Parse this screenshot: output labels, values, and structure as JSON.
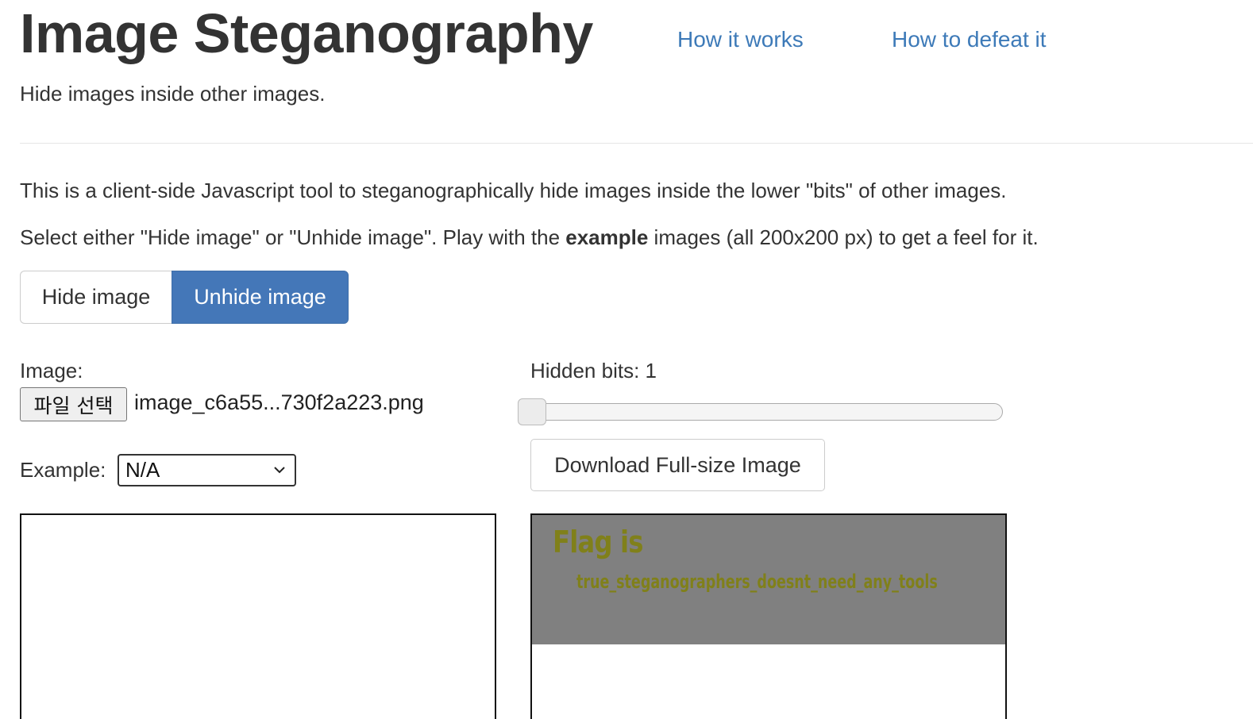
{
  "header": {
    "title": "Image Steganography",
    "nav": [
      "How it works",
      "How to defeat it"
    ],
    "subtitle": "Hide images inside other images."
  },
  "intro": {
    "line1": "This is a client-side Javascript tool to steganographically hide images inside the lower \"bits\" of other images.",
    "line2_prefix": "Select either \"Hide image\" or \"Unhide image\". Play with the ",
    "line2_bold": "example",
    "line2_suffix": " images (all 200x200 px) to get a feel for it."
  },
  "mode": {
    "options": [
      "Hide image",
      "Unhide image"
    ],
    "selected": "Unhide image",
    "accent_color": "#4477b8"
  },
  "image_input": {
    "label": "Image:",
    "button_label": "파일 선택",
    "file_name": "image_c6a55...730f2a223.png"
  },
  "example": {
    "label": "Example:",
    "selected": "N/A"
  },
  "hidden_bits": {
    "label": "Hidden bits: 1",
    "value": 1,
    "min": 1,
    "max": 7
  },
  "download": {
    "label": "Download Full-size Image"
  },
  "revealed_image": {
    "heading": "Flag is",
    "text": "true_steganographers_doesnt_need_any_tools",
    "text_color": "#80801a",
    "background": "#808080"
  }
}
